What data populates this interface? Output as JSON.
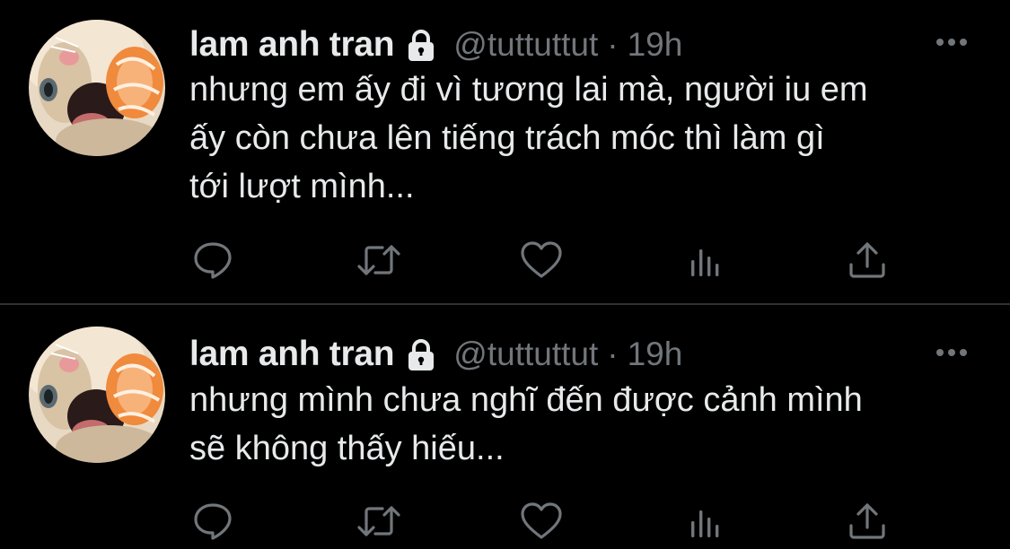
{
  "colors": {
    "background": "#000000",
    "text_primary": "#e7e9ea",
    "text_secondary": "#71767b",
    "divider": "#2f3336"
  },
  "tweets": [
    {
      "display_name": "lam anh tran",
      "handle": "@tuttuttut",
      "separator": "·",
      "time": "19h",
      "text_lines": [
        "nhưng em ấy đi vì tương lai mà, người iu em",
        "ấy còn chưa lên tiếng trách móc thì làm gì",
        "tới lượt mình..."
      ],
      "icons": {
        "protected": "lock-icon",
        "more": "more-horizontal-icon",
        "reply": "reply-icon",
        "retweet": "retweet-icon",
        "like": "heart-icon",
        "views": "views-icon",
        "share": "share-icon"
      }
    },
    {
      "display_name": "lam anh tran",
      "handle": "@tuttuttut",
      "separator": "·",
      "time": "19h",
      "text_lines": [
        "nhưng mình chưa nghĩ đến được cảnh mình",
        "sẽ không thấy hiếu..."
      ],
      "icons": {
        "protected": "lock-icon",
        "more": "more-horizontal-icon",
        "reply": "reply-icon",
        "retweet": "retweet-icon",
        "like": "heart-icon",
        "views": "views-icon",
        "share": "share-icon"
      }
    }
  ]
}
